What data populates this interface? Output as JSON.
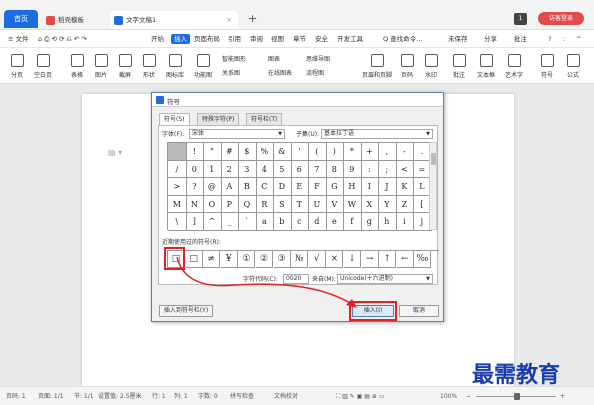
{
  "titlebar": {
    "home_tab": "首页",
    "wps_tab": "稻壳模板",
    "doc_tab": "文字文稿1",
    "close": "×",
    "plus": "+",
    "page_num": "1",
    "login": "访客登录",
    "wps_color": "#e24b4b",
    "doc_color": "#1d6de0"
  },
  "menubar": {
    "items": [
      "≡ 文件",
      "开始",
      "插入",
      "页面布局",
      "引用",
      "审阅",
      "视图",
      "章节",
      "安全",
      "开发工具"
    ],
    "active": "插入",
    "search": "Q 查找命令...",
    "save": "未保存",
    "share": "分享",
    "comment": "批注",
    "help": "?",
    "more": ":",
    "collapse": "^"
  },
  "ribbon": {
    "items": [
      "分页",
      "空白页",
      "表格",
      "图片",
      "截屏",
      "形状",
      "图标库",
      "功能图",
      "页眉和页脚",
      "页码",
      "水印",
      "批注",
      "文本框",
      "艺术字",
      "符号",
      "公式"
    ],
    "small": [
      "智能图形",
      "图表",
      "思维导图",
      "关系图",
      "在线图表",
      "流程图"
    ]
  },
  "dialog": {
    "title": "符号",
    "tabs": [
      "符号(S)",
      "特殊字符(P)",
      "符号栏(T)"
    ],
    "font_label": "字体(F):",
    "font_value": "宋体",
    "subset_label": "子集(U):",
    "subset_value": "基本拉丁语",
    "symbols": [
      [
        "",
        "!",
        "\"",
        "#",
        "$",
        "%",
        "&",
        "'",
        "(",
        ")",
        "*",
        "+",
        ",",
        "-",
        "."
      ],
      [
        "/",
        "0",
        "1",
        "2",
        "3",
        "4",
        "5",
        "6",
        "7",
        "8",
        "9",
        ":",
        ";",
        "<",
        "="
      ],
      [
        ">",
        "?",
        "@",
        "A",
        "B",
        "C",
        "D",
        "E",
        "F",
        "G",
        "H",
        "I",
        "J",
        "K",
        "L"
      ],
      [
        "M",
        "N",
        "O",
        "P",
        "Q",
        "R",
        "S",
        "T",
        "U",
        "V",
        "W",
        "X",
        "Y",
        "Z",
        "["
      ],
      [
        "\\",
        "]",
        "^",
        "_",
        "`",
        "a",
        "b",
        "c",
        "d",
        "e",
        "f",
        "g",
        "h",
        "i",
        "j"
      ]
    ],
    "recent_label": "近期使用过的符号(R):",
    "recent": [
      "□",
      "□",
      "≠",
      "¥",
      "①",
      "②",
      "③",
      "№",
      "√",
      "×",
      "↓",
      "→",
      "↑",
      "←",
      "‰"
    ],
    "code_label": "字符代码(C):",
    "code_value": "0020",
    "from_label": "来自(M):",
    "from_value": "Unicode(十六进制)",
    "insert_bar": "插入到符号栏(Y)",
    "insert": "插入(I)",
    "cancel": "取消"
  },
  "statusbar": {
    "items": [
      "页码: 1",
      "页面: 1/1",
      "节: 1/1",
      "设置值: 2.5厘米",
      "行: 1",
      "列: 1",
      "字数: 0",
      "拼写检查",
      "文档校对"
    ],
    "zoom": "100%",
    "minus": "−",
    "plus": "+"
  },
  "watermark": "最需教育"
}
